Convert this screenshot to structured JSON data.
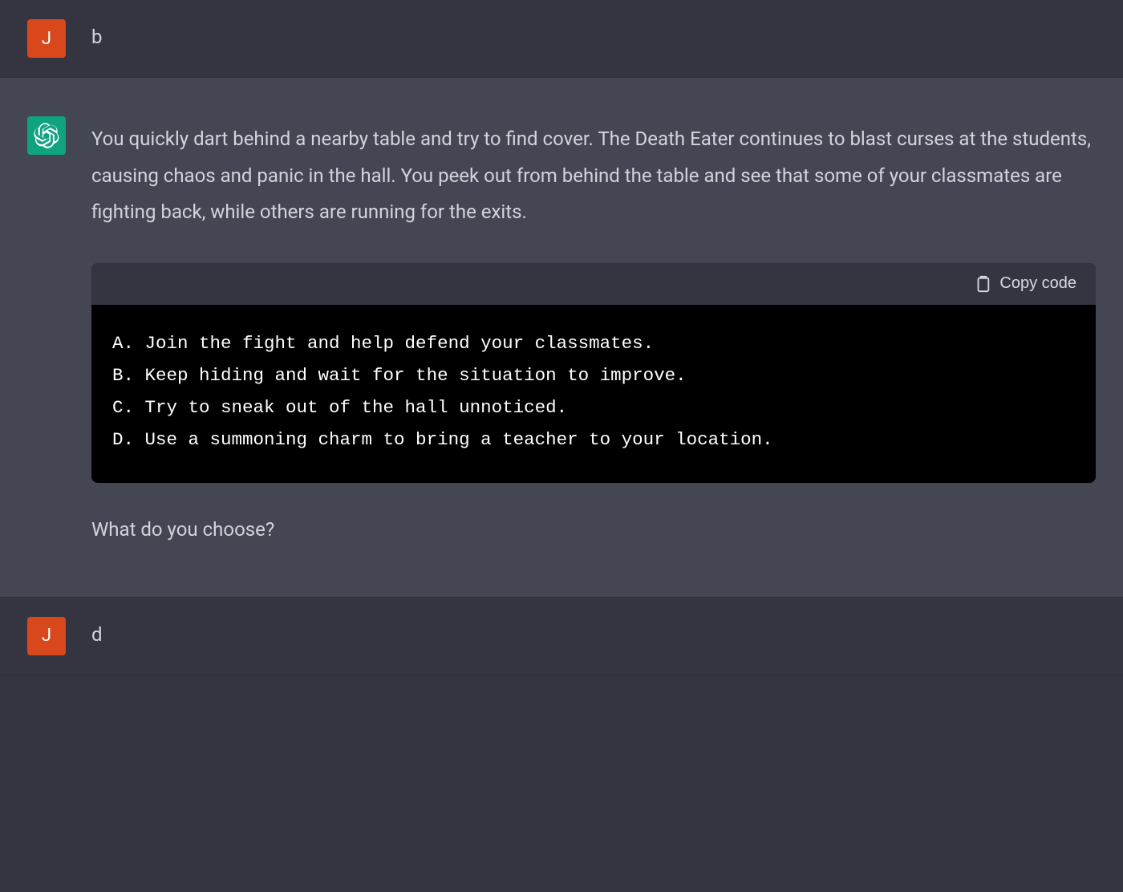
{
  "messages": {
    "user1": {
      "avatar_letter": "J",
      "text": "b"
    },
    "assistant1": {
      "paragraph1": "You quickly dart behind a nearby table and try to find cover. The Death Eater continues to blast curses at the students, causing chaos and panic in the hall. You peek out from behind the table and see that some of your classmates are fighting back, while others are running for the exits.",
      "code_block": {
        "copy_label": "Copy code",
        "lines": [
          "A. Join the fight and help defend your classmates.",
          "B. Keep hiding and wait for the situation to improve.",
          "C. Try to sneak out of the hall unnoticed.",
          "D. Use a summoning charm to bring a teacher to your location."
        ]
      },
      "prompt": "What do you choose?"
    },
    "user2": {
      "avatar_letter": "J",
      "text": "d"
    }
  },
  "colors": {
    "user_avatar_bg": "#d9481c",
    "assistant_avatar_bg": "#10a37f",
    "user_bg": "#343541",
    "assistant_bg": "#444654"
  }
}
